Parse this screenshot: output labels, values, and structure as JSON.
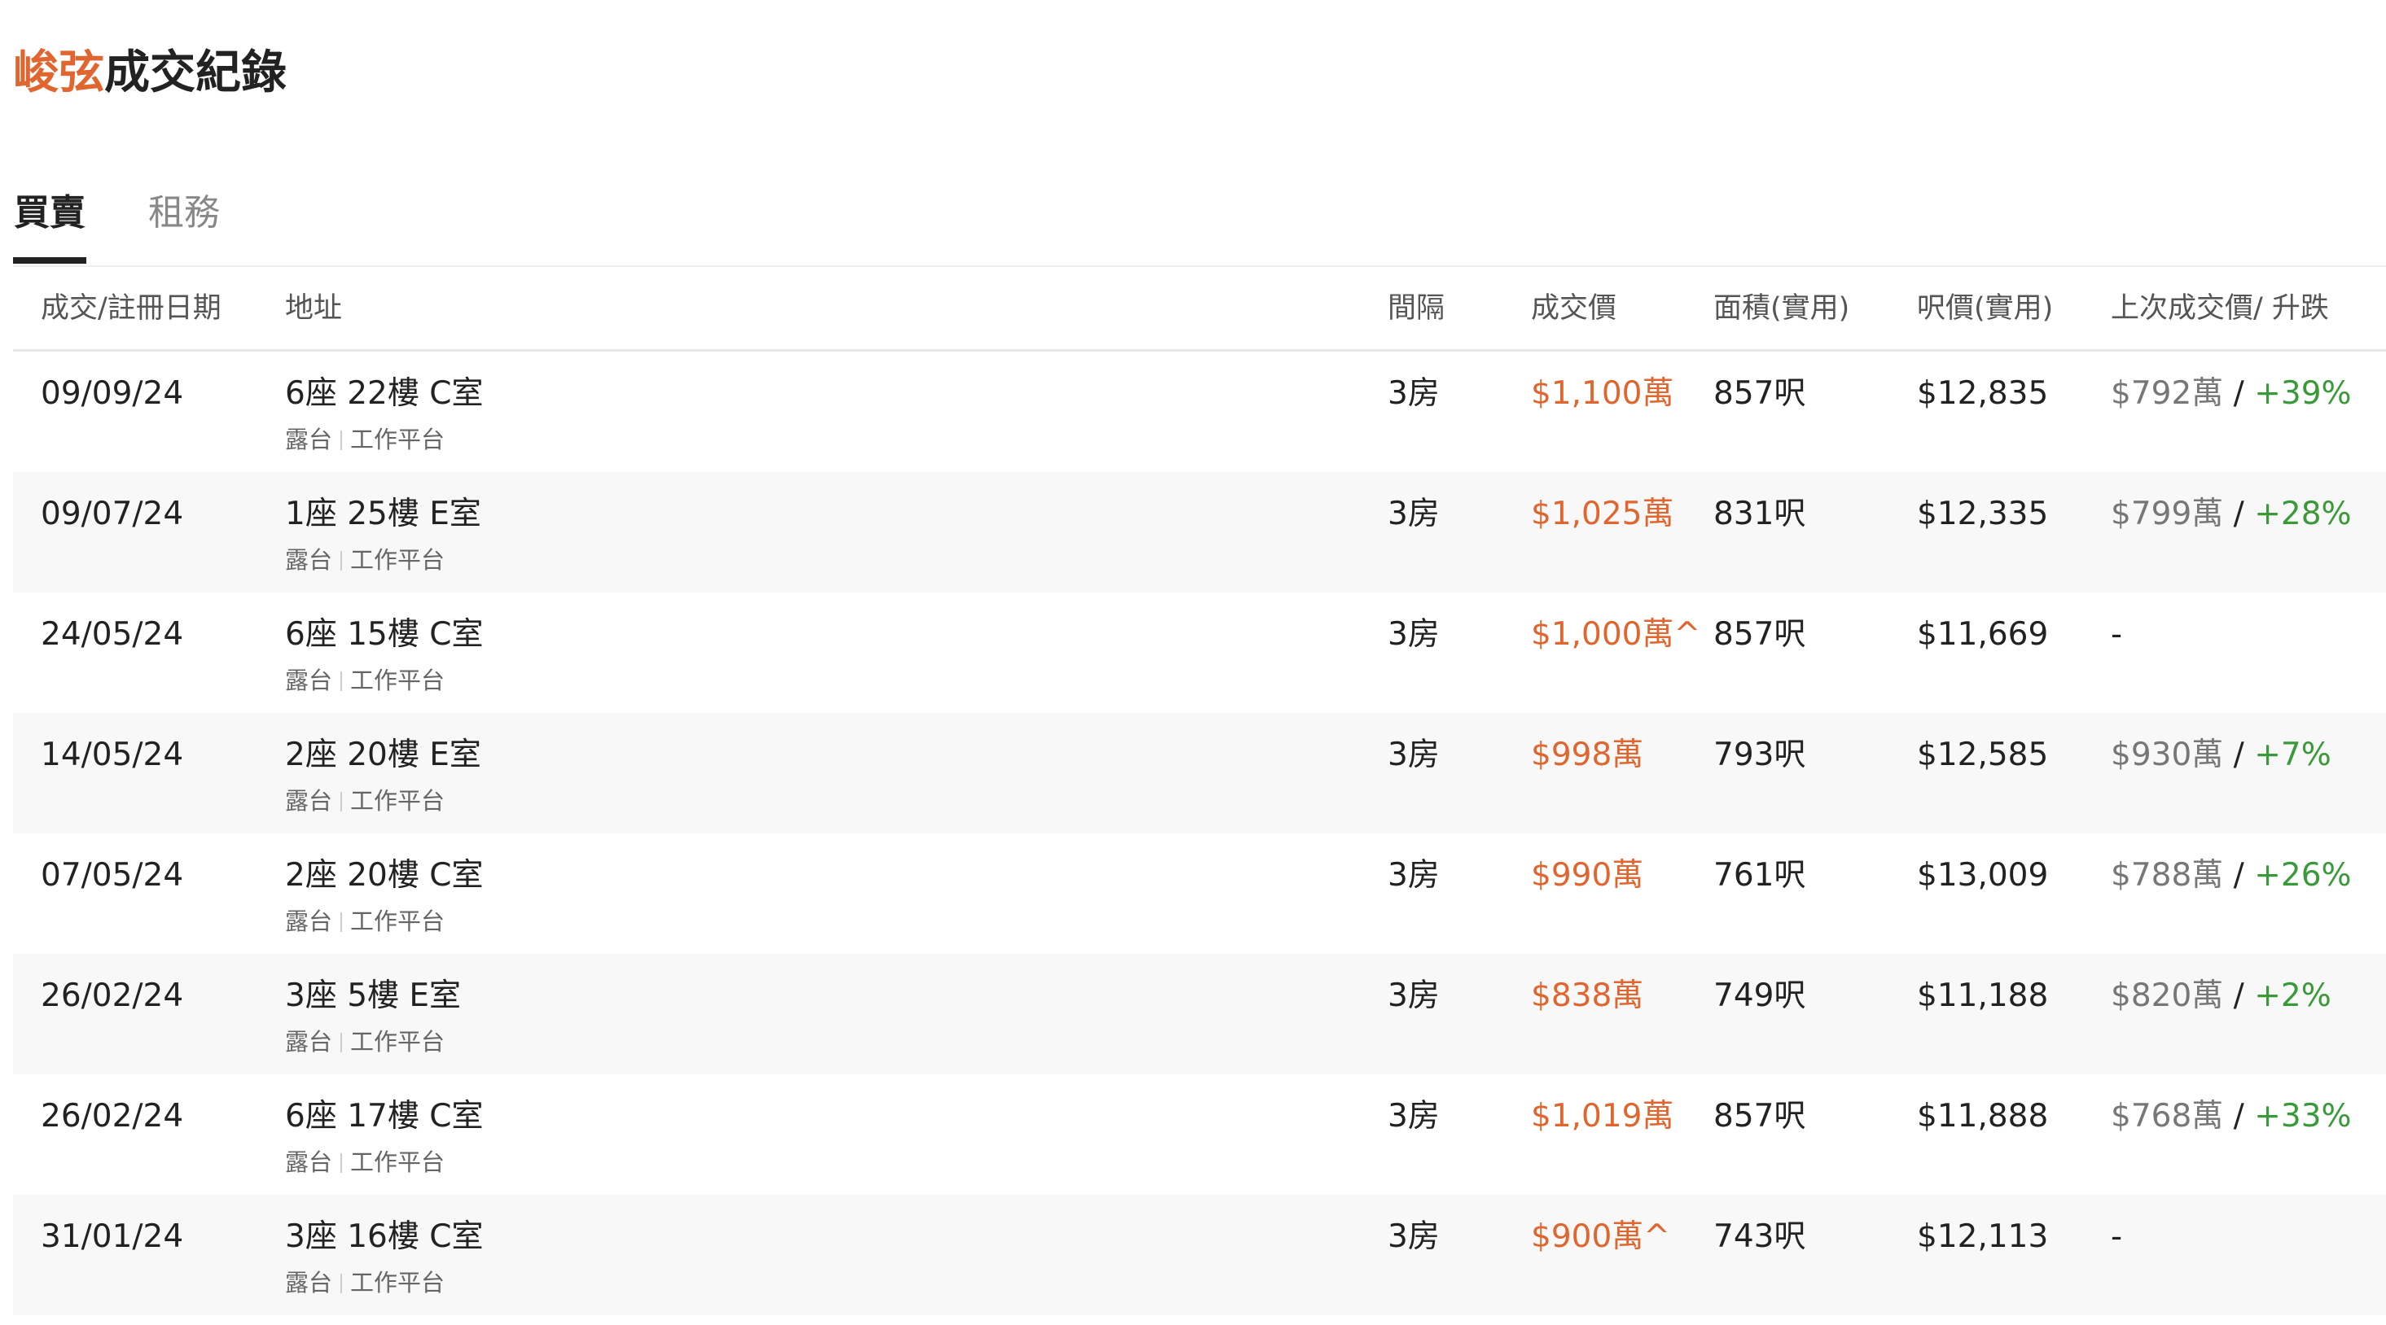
{
  "title": {
    "accent": "峻弦",
    "rest": "成交紀錄"
  },
  "tabs": [
    {
      "label": "買賣",
      "active": true
    },
    {
      "label": "租務",
      "active": false
    }
  ],
  "table": {
    "headers": {
      "date": "成交/註冊日期",
      "address": "地址",
      "rooms": "間隔",
      "price": "成交價",
      "area": "面積(實用)",
      "sqft_price": "呎價(實用)",
      "previous": "上次成交價/ 升跌"
    },
    "rows": [
      {
        "date": "09/09/24",
        "address": "6座 22樓 C室",
        "tag1": "露台",
        "tag2": "工作平台",
        "rooms": "3房",
        "price": "$1,100萬",
        "area": "857呎",
        "sqft_price": "$12,835",
        "prev_price": "$792萬",
        "prev_sep": " / ",
        "prev_change": "+39%",
        "prev_dash": ""
      },
      {
        "date": "09/07/24",
        "address": "1座 25樓 E室",
        "tag1": "露台",
        "tag2": "工作平台",
        "rooms": "3房",
        "price": "$1,025萬",
        "area": "831呎",
        "sqft_price": "$12,335",
        "prev_price": "$799萬",
        "prev_sep": " / ",
        "prev_change": "+28%",
        "prev_dash": ""
      },
      {
        "date": "24/05/24",
        "address": "6座 15樓 C室",
        "tag1": "露台",
        "tag2": "工作平台",
        "rooms": "3房",
        "price": "$1,000萬^",
        "area": "857呎",
        "sqft_price": "$11,669",
        "prev_price": "",
        "prev_sep": "",
        "prev_change": "",
        "prev_dash": "-"
      },
      {
        "date": "14/05/24",
        "address": "2座 20樓 E室",
        "tag1": "露台",
        "tag2": "工作平台",
        "rooms": "3房",
        "price": "$998萬",
        "area": "793呎",
        "sqft_price": "$12,585",
        "prev_price": "$930萬",
        "prev_sep": " / ",
        "prev_change": "+7%",
        "prev_dash": ""
      },
      {
        "date": "07/05/24",
        "address": "2座 20樓 C室",
        "tag1": "露台",
        "tag2": "工作平台",
        "rooms": "3房",
        "price": "$990萬",
        "area": "761呎",
        "sqft_price": "$13,009",
        "prev_price": "$788萬",
        "prev_sep": " / ",
        "prev_change": "+26%",
        "prev_dash": ""
      },
      {
        "date": "26/02/24",
        "address": "3座 5樓 E室",
        "tag1": "露台",
        "tag2": "工作平台",
        "rooms": "3房",
        "price": "$838萬",
        "area": "749呎",
        "sqft_price": "$11,188",
        "prev_price": "$820萬",
        "prev_sep": " / ",
        "prev_change": "+2%",
        "prev_dash": ""
      },
      {
        "date": "26/02/24",
        "address": "6座 17樓 C室",
        "tag1": "露台",
        "tag2": "工作平台",
        "rooms": "3房",
        "price": "$1,019萬",
        "area": "857呎",
        "sqft_price": "$11,888",
        "prev_price": "$768萬",
        "prev_sep": " / ",
        "prev_change": "+33%",
        "prev_dash": ""
      },
      {
        "date": "31/01/24",
        "address": "3座 16樓 C室",
        "tag1": "露台",
        "tag2": "工作平台",
        "rooms": "3房",
        "price": "$900萬^",
        "area": "743呎",
        "sqft_price": "$12,113",
        "prev_price": "",
        "prev_sep": "",
        "prev_change": "",
        "prev_dash": "-"
      }
    ]
  },
  "colors": {
    "accent": "#e0652f",
    "increase": "#3a9a3a",
    "muted": "#777777",
    "row_alt": "#f8f8f8"
  }
}
